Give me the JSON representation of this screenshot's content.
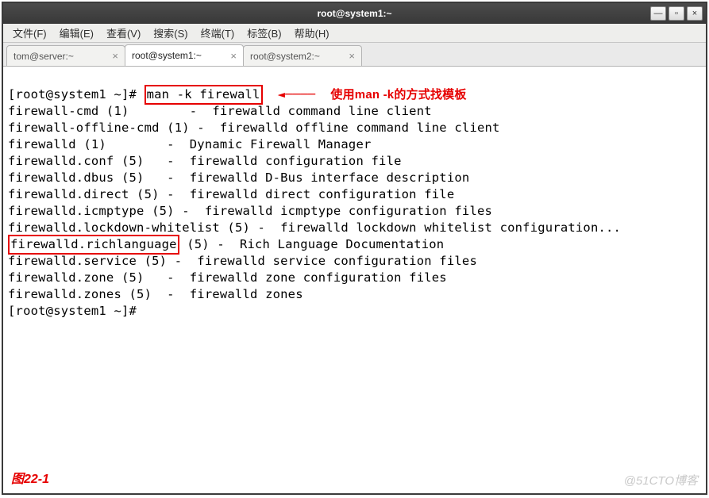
{
  "window": {
    "title": "root@system1:~",
    "controls": {
      "minimize": "—",
      "maximize": "▫",
      "close": "×"
    }
  },
  "menubar": [
    "文件(F)",
    "编辑(E)",
    "查看(V)",
    "搜索(S)",
    "终端(T)",
    "标签(B)",
    "帮助(H)"
  ],
  "tabs": [
    {
      "label": "tom@server:~",
      "active": false
    },
    {
      "label": "root@system1:~",
      "active": true
    },
    {
      "label": "root@system2:~",
      "active": false
    }
  ],
  "annotations": {
    "arrow_text": "使用man -k的方式找模板",
    "highlight_command": "man -k firewall",
    "highlight_entry": "firewalld.richlanguage"
  },
  "terminal": {
    "prompt1": "[root@system1 ~]#",
    "cmd": "man -k firewall",
    "lines": [
      "firewall-cmd (1)        -  firewalld command line client",
      "firewall-offline-cmd (1) -  firewalld offline command line client",
      "firewalld (1)        -  Dynamic Firewall Manager",
      "firewalld.conf (5)   -  firewalld configuration file",
      "firewalld.dbus (5)   -  firewalld D-Bus interface description",
      "firewalld.direct (5) -  firewalld direct configuration file",
      "firewalld.icmptype (5) -  firewalld icmptype configuration files",
      "firewalld.lockdown-whitelist (5) -  firewalld lockdown whitelist configuration...",
      "firewalld.richlanguage (5) -  Rich Language Documentation",
      "firewalld.service (5) -  firewalld service configuration files",
      "firewalld.zone (5)   -  firewalld zone configuration files",
      "firewalld.zones (5)  -  firewalld zones"
    ],
    "prompt2": "[root@system1 ~]#"
  },
  "figure_label": "图22-1",
  "watermark": "@51CTO博客"
}
